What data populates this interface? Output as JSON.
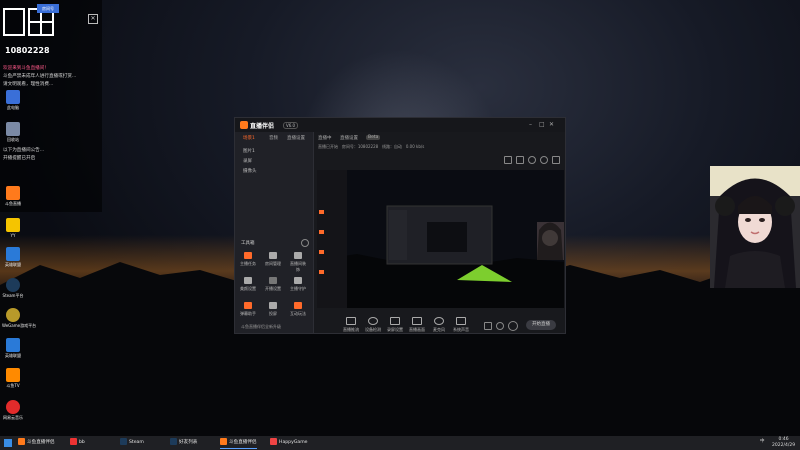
{
  "overlay": {
    "room_label": "房间号",
    "room_number": "10802228",
    "lines": [
      "欢迎来到斗鱼直播间！",
      "斗鱼严禁未成年人进行直播或打赏...",
      "请文明观看，理性消费...",
      "以下为直播间公告...",
      "开播提醒已开启"
    ]
  },
  "desktop_icons": [
    {
      "label": "此电脑",
      "color": "#3a6fd8"
    },
    {
      "label": "回收站",
      "color": "#7b8aa5"
    },
    {
      "label": "斗鱼直播",
      "color": "#ff7a1c"
    },
    {
      "label": "YY",
      "color": "#f5c400"
    },
    {
      "label": "Steam平台",
      "color": "#1d3b5a"
    },
    {
      "label": "WeGame游戏平台",
      "color": "#b89a2a"
    },
    {
      "label": "英雄联盟",
      "color": "#2a7ad8"
    },
    {
      "label": "斗鱼TV",
      "color": "#ff8a00"
    },
    {
      "label": "网易云音乐",
      "color": "#e22b2b"
    }
  ],
  "app": {
    "title": "直播伴侣",
    "version": "V6.0",
    "left_tabs": [
      "场景1",
      "音频",
      "直播设置"
    ],
    "scenes": [
      "图片1",
      "录屏",
      "摄像头"
    ],
    "tools_heading": "工具箱",
    "tools": [
      "主播任务",
      "房间管理",
      "直播间装饰",
      "美颜设置",
      "开播设置",
      "主播守护",
      "弹幕助手",
      "投屏",
      "互动玩法"
    ],
    "footer_note": "斗鱼直播伴侣全新升级",
    "top_tabs": [
      "直播中",
      "直播设置",
      "Beta"
    ],
    "status": [
      "直播已开始",
      "房间号：10802228",
      "线路：自动",
      "0.00 kb/s"
    ],
    "bottom_buttons": [
      "直播推流",
      "设备检测",
      "录屏设置",
      "直播画面",
      "麦克风",
      "系统声音"
    ],
    "start_button": "开始直播",
    "icons": [
      "settings-icon",
      "mic-icon",
      "speaker-icon",
      "monitor-icon",
      "camera-icon"
    ]
  },
  "taskbar": {
    "items": [
      {
        "label": "斗鱼直播伴侣",
        "color": "#ff7a1c"
      },
      {
        "label": "bb",
        "color": "#e33"
      },
      {
        "label": "Steam",
        "color": "#1d3b5a"
      },
      {
        "label": "好友列表",
        "color": "#1d3b5a"
      },
      {
        "label": "斗鱼直播伴侣",
        "color": "#ff7a1c"
      },
      {
        "label": "HappyGame",
        "color": "#e44"
      }
    ],
    "time": "0:46",
    "date": "2022/4/29",
    "tray": "中"
  }
}
